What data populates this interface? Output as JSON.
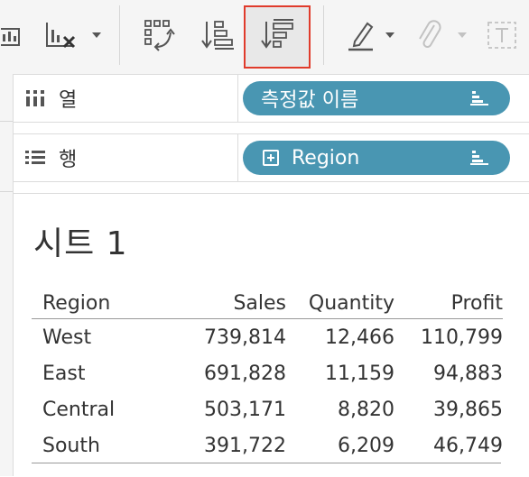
{
  "toolbar": {
    "buttons": [
      {
        "icon": "show-me-chart-icon"
      },
      {
        "icon": "clear-sheet-icon"
      },
      {
        "icon": "dropdown-caret-icon"
      },
      {
        "icon": "swap-rows-columns-icon"
      },
      {
        "icon": "sort-ascending-icon"
      },
      {
        "icon": "sort-descending-icon",
        "active": true
      },
      {
        "icon": "highlight-pen-icon"
      },
      {
        "icon": "annotate-clip-icon"
      },
      {
        "icon": "text-label-icon"
      }
    ],
    "highlight_color": "#e03b2b"
  },
  "shelves": {
    "columns": {
      "label": "열",
      "icon": "columns-icon",
      "pill": "측정값 이름"
    },
    "rows": {
      "label": "행",
      "icon": "rows-icon",
      "pill": "Region"
    }
  },
  "pill_color": "#4996b2",
  "sheet": {
    "title": "시트 1",
    "headers": [
      "Region",
      "Sales",
      "Quantity",
      "Profit"
    ],
    "rows": [
      [
        "West",
        "739,814",
        "12,466",
        "110,799"
      ],
      [
        "East",
        "691,828",
        "11,159",
        "94,883"
      ],
      [
        "Central",
        "503,171",
        "8,820",
        "39,865"
      ],
      [
        "South",
        "391,722",
        "6,209",
        "46,749"
      ]
    ]
  }
}
